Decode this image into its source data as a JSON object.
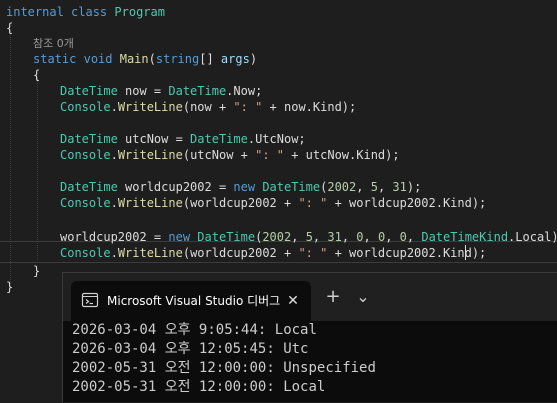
{
  "code": {
    "class_decl": [
      "internal",
      "class",
      "Program"
    ],
    "open_brace": "{",
    "ref_count": "참조 0개",
    "method_decl": [
      "static",
      "void",
      "Main",
      "(",
      "string",
      "[] ",
      "args",
      ")"
    ],
    "method_open": "{",
    "stmt1": [
      "DateTime",
      " now = ",
      "DateTime",
      ".Now;"
    ],
    "stmt2": [
      "Console",
      ".",
      "WriteLine",
      "(now + ",
      "\": \"",
      " + now.Kind);"
    ],
    "stmt3": [
      "DateTime",
      " utcNow = ",
      "DateTime",
      ".UtcNow;"
    ],
    "stmt4": [
      "Console",
      ".",
      "WriteLine",
      "(utcNow + ",
      "\": \"",
      " + utcNow.Kind);"
    ],
    "stmt5": [
      "DateTime",
      " worldcup2002 = ",
      "new",
      " ",
      "DateTime",
      "(",
      "2002",
      ", ",
      "5",
      ", ",
      "31",
      ");"
    ],
    "stmt6": [
      "Console",
      ".",
      "WriteLine",
      "(worldcup2002 + ",
      "\": \"",
      " + worldcup2002.Kind);"
    ],
    "stmt7": [
      "worldcup2002 = ",
      "new",
      " ",
      "DateTime",
      "(",
      "2002",
      ", ",
      "5",
      ", ",
      "31",
      ", ",
      "0",
      ", ",
      "0",
      ", ",
      "0",
      ", ",
      "DateTimeKind",
      ".Local);"
    ],
    "stmt8": [
      "Console",
      ".",
      "WriteLine",
      "(worldcup2002 + ",
      "\": \"",
      " + worldcup2002.Kind);"
    ],
    "method_close": "}",
    "class_close": "}"
  },
  "terminal": {
    "tab_title": "Microsoft Visual Studio 디버그",
    "close_glyph": "✕",
    "new_tab_glyph": "+",
    "dropdown_glyph": "⌄",
    "icon": "terminal-icon",
    "output": [
      "2026-03-04 오후 9:05:44: Local",
      "2026-03-04 오후 12:05:45: Utc",
      "2002-05-31 오전 12:00:00: Unspecified",
      "2002-05-31 오전 12:00:00: Local"
    ]
  },
  "colors": {
    "editor_bg": "#1e1e1e",
    "keyword": "#569cd6",
    "type": "#4ec9b0",
    "method": "#dcdcaa",
    "string": "#d69d85",
    "number": "#b5cea8",
    "terminal_bg": "#0c0c0c"
  }
}
